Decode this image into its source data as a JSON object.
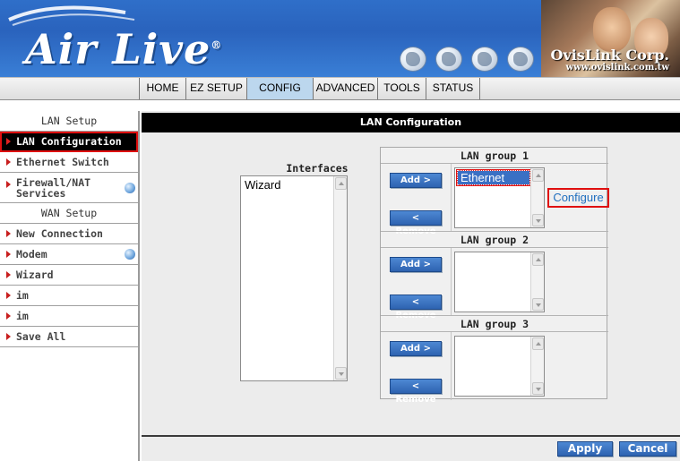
{
  "header": {
    "logo_text": "Air Live",
    "logo_mark": "®",
    "brand": "OvisLink Corp.",
    "url": "www.ovislink.com.tw",
    "globe_icons": [
      "globe-icon",
      "globe-icon",
      "globe-icon",
      "globe-icon"
    ]
  },
  "nav": {
    "tabs": [
      {
        "label": "HOME",
        "active": false
      },
      {
        "label": "EZ SETUP",
        "active": false
      },
      {
        "label": "CONFIG",
        "active": true
      },
      {
        "label": "ADVANCED",
        "active": false
      },
      {
        "label": "TOOLS",
        "active": false
      },
      {
        "label": "STATUS",
        "active": false
      }
    ],
    "active_color": "#bcd7ee"
  },
  "sidebar": {
    "sections": [
      {
        "type": "header",
        "label": "LAN Setup"
      },
      {
        "type": "item",
        "label": "LAN Configuration",
        "active": true
      },
      {
        "type": "item",
        "label": "Ethernet Switch"
      },
      {
        "type": "item",
        "label": "Firewall/NAT Services",
        "line1": "Firewall/NAT",
        "line2": "Services",
        "badge_icon": "info-dot-icon"
      },
      {
        "type": "header",
        "label": "WAN Setup"
      },
      {
        "type": "item",
        "label": "New Connection"
      },
      {
        "type": "item",
        "label": "Modem",
        "badge_icon": "info-dot-icon"
      },
      {
        "type": "item",
        "label": "Wizard"
      },
      {
        "type": "item",
        "label": "im"
      },
      {
        "type": "item",
        "label": "im"
      },
      {
        "type": "item",
        "label": "Save All"
      }
    ]
  },
  "main": {
    "title": "LAN Configuration",
    "interfaces_label": "Interfaces",
    "interfaces_options": [
      "Wizard"
    ],
    "groups": [
      {
        "title": "LAN group 1",
        "options": [
          {
            "label": "Ethernet",
            "selected": true
          }
        ],
        "add_label": "Add >",
        "remove_label": "< Remove"
      },
      {
        "title": "LAN group 2",
        "options": [],
        "add_label": "Add >",
        "remove_label": "< Remove"
      },
      {
        "title": "LAN group 3",
        "options": [],
        "add_label": "Add >",
        "remove_label": "< Remove"
      }
    ],
    "configure_link": "Configure",
    "apply_label": "Apply",
    "cancel_label": "Cancel"
  },
  "colors": {
    "accent_blue": "#2e63b1",
    "highlight_red": "#e01010",
    "link_blue": "#1f6fbf"
  }
}
